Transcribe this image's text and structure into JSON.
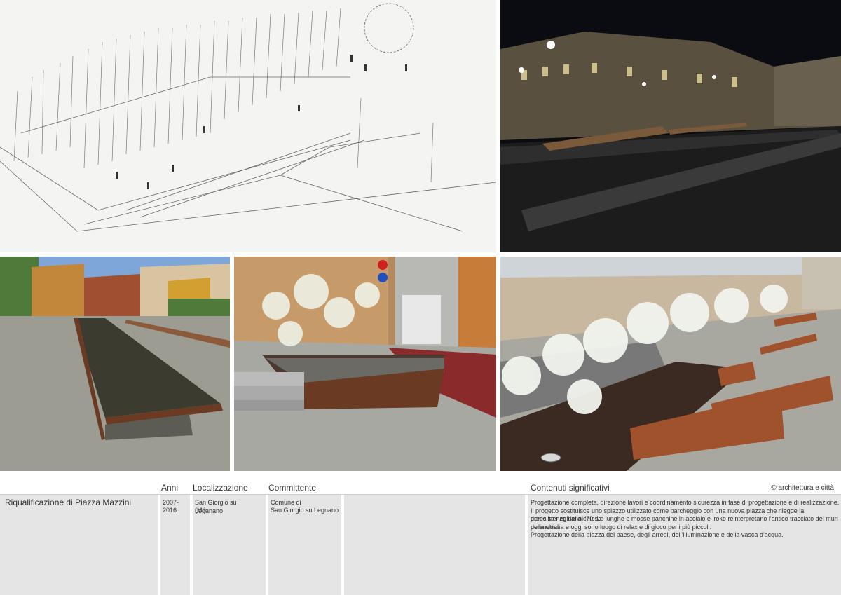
{
  "project": {
    "title": "Riqualificazione di Piazza Mazzini",
    "copyright": "© architettura e città"
  },
  "headers": {
    "anni": "Anni",
    "localizzazione": "Localizzazione",
    "committente": "Committente",
    "contenuti": "Contenuti significativi"
  },
  "values": {
    "anni_line1": "2007-",
    "anni_line2": "2016",
    "localizzazione_line1": "San Giorgio su Leganano",
    "localizzazione_line2": "(MI)",
    "committente_line1": "Comune di",
    "committente_line2": "San Giorgio su Legnano",
    "contenuti": [
      "Progettazione completa, direzione lavori e coordinamento sicurezza in fase di progettazione e di realizzazione.",
      "Il progetto sostituisce uno spiazzo utilizzato come parcheggio con una nuova piazza che rilegge la preesistenza della chiesa",
      "demolita negli anni '70. Le lunghe e mosse panchine in acciaio e iroko reinterpretano l'antico tracciato dei muri perimetrali",
      "della chiesa e oggi sono luogo di relax e di gioco per i più piccoli.",
      "Progettazione della piazza del paese, degli arredi, dell'illuminazione e della vasca d'acqua."
    ]
  },
  "colors": {
    "table_bg": "#e5e5e5",
    "corten": "#6b3a22",
    "wood": "#a0522d",
    "stone": "#9c9c92",
    "night_sky": "#0b0b12"
  }
}
